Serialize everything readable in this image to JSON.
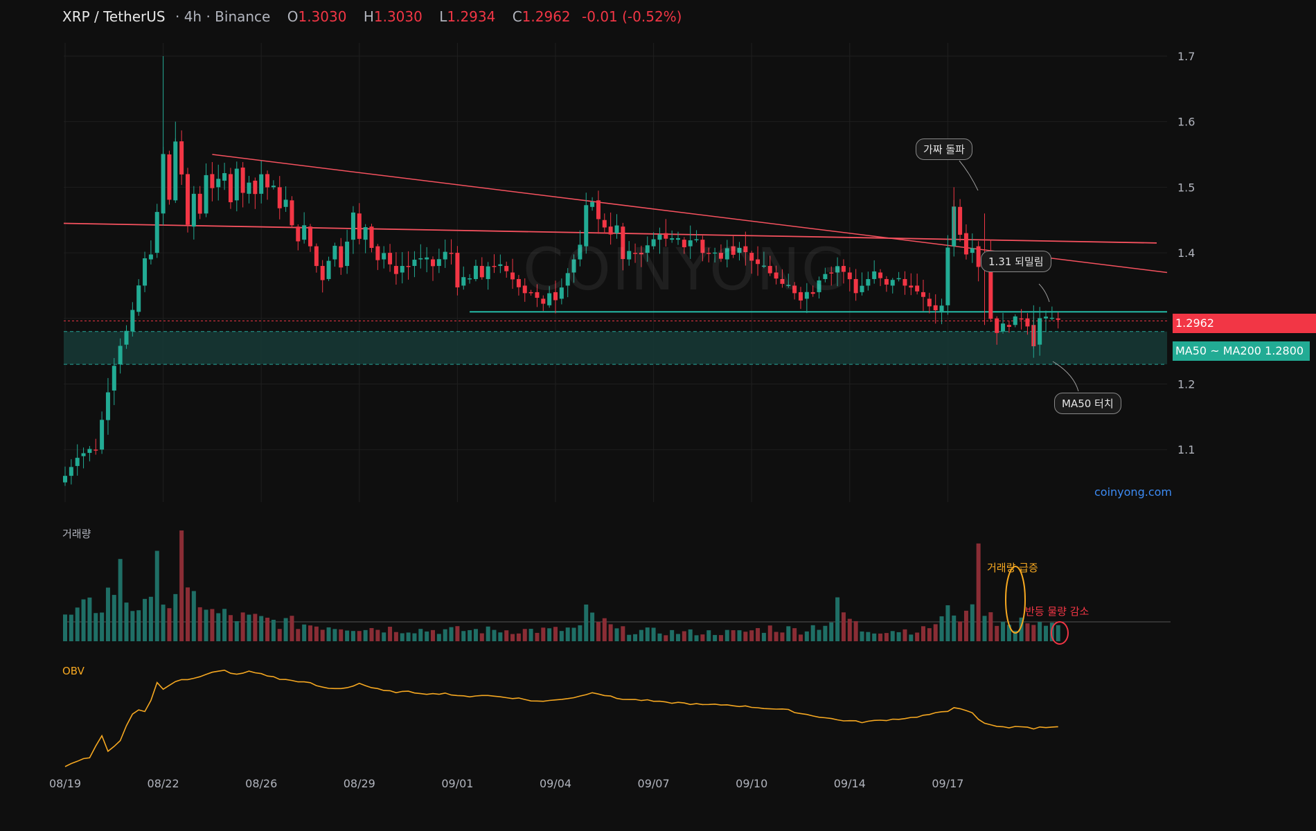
{
  "header": {
    "symbol": "XRP / TetherUS",
    "interval_exchange": "· 4h · Binance",
    "open_label": "O",
    "open": "1.3030",
    "high_label": "H",
    "high": "1.3030",
    "low_label": "L",
    "low": "1.2934",
    "close_label": "C",
    "close": "1.2962",
    "change": "-0.01 (-0.52%)"
  },
  "watermark": "COINYONG",
  "site": "coinyong.com",
  "panes": {
    "volume_title": "거래량",
    "obv_title": "OBV"
  },
  "price_tags": {
    "last": "1.2962",
    "ma_zone": "MA50 ~ MA200 1.2800"
  },
  "annotations": {
    "fake_breakout": "가짜 돌파",
    "pullback": "1.31 되밀림",
    "ma50_touch": "MA50 터치",
    "volume_spike": "거래량 급증",
    "rebound_volume_drop": "반등 물량 감소"
  },
  "colors": {
    "up": "#22ab94",
    "down": "#f23645",
    "background": "#0f0f0f",
    "obv": "#f6a821",
    "trendline": "#f7525f",
    "support": "#26c6b0"
  },
  "chart_data": {
    "type": "candlestick",
    "title": "XRP / TetherUS · 4h · Binance",
    "x_ticks": [
      "08/19",
      "08/22",
      "08/26",
      "08/29",
      "09/01",
      "09/04",
      "09/07",
      "09/10",
      "09/14",
      "09/17"
    ],
    "y_ticks": [
      1.1,
      1.2,
      1.3,
      1.4,
      1.5,
      1.6,
      1.7
    ],
    "ylim": [
      1.02,
      1.72
    ],
    "x_index_range": [
      0,
      180
    ],
    "last_price": 1.2962,
    "support_line": 1.31,
    "ma_zone": [
      1.23,
      1.28
    ],
    "candle_anchors_close": [
      [
        0,
        1.06
      ],
      [
        2,
        1.09
      ],
      [
        4,
        1.1
      ],
      [
        5,
        1.1
      ],
      [
        7,
        1.19
      ],
      [
        8,
        1.23
      ],
      [
        9,
        1.26
      ],
      [
        10,
        1.28
      ],
      [
        11,
        1.31
      ],
      [
        12,
        1.35
      ],
      [
        13,
        1.39
      ],
      [
        14,
        1.4
      ],
      [
        15,
        1.46
      ],
      [
        16,
        1.55
      ],
      [
        17,
        1.48
      ],
      [
        18,
        1.57
      ],
      [
        19,
        1.52
      ],
      [
        20,
        1.44
      ],
      [
        21,
        1.49
      ],
      [
        22,
        1.46
      ],
      [
        23,
        1.52
      ],
      [
        24,
        1.5
      ],
      [
        25,
        1.51
      ],
      [
        26,
        1.52
      ],
      [
        27,
        1.48
      ],
      [
        28,
        1.53
      ],
      [
        29,
        1.49
      ],
      [
        30,
        1.51
      ],
      [
        31,
        1.49
      ],
      [
        32,
        1.52
      ],
      [
        33,
        1.5
      ],
      [
        34,
        1.5
      ],
      [
        35,
        1.47
      ],
      [
        36,
        1.48
      ],
      [
        37,
        1.44
      ],
      [
        38,
        1.42
      ],
      [
        39,
        1.44
      ],
      [
        40,
        1.41
      ],
      [
        41,
        1.38
      ],
      [
        42,
        1.36
      ],
      [
        43,
        1.39
      ],
      [
        44,
        1.41
      ],
      [
        45,
        1.38
      ],
      [
        46,
        1.42
      ],
      [
        47,
        1.46
      ],
      [
        48,
        1.42
      ],
      [
        49,
        1.44
      ],
      [
        50,
        1.41
      ],
      [
        51,
        1.39
      ],
      [
        52,
        1.4
      ],
      [
        53,
        1.38
      ],
      [
        54,
        1.37
      ],
      [
        55,
        1.38
      ],
      [
        56,
        1.38
      ],
      [
        57,
        1.39
      ],
      [
        58,
        1.39
      ],
      [
        59,
        1.39
      ],
      [
        60,
        1.38
      ],
      [
        62,
        1.4
      ],
      [
        63,
        1.4
      ],
      [
        64,
        1.35
      ],
      [
        65,
        1.36
      ],
      [
        66,
        1.36
      ],
      [
        67,
        1.38
      ],
      [
        68,
        1.36
      ],
      [
        69,
        1.38
      ],
      [
        70,
        1.38
      ],
      [
        71,
        1.38
      ],
      [
        72,
        1.37
      ],
      [
        74,
        1.35
      ],
      [
        75,
        1.34
      ],
      [
        76,
        1.34
      ],
      [
        77,
        1.33
      ],
      [
        78,
        1.32
      ],
      [
        79,
        1.34
      ],
      [
        80,
        1.33
      ],
      [
        81,
        1.35
      ],
      [
        82,
        1.37
      ],
      [
        83,
        1.39
      ],
      [
        84,
        1.41
      ],
      [
        85,
        1.47
      ],
      [
        86,
        1.48
      ],
      [
        87,
        1.45
      ],
      [
        88,
        1.44
      ],
      [
        89,
        1.43
      ],
      [
        90,
        1.44
      ],
      [
        91,
        1.39
      ],
      [
        92,
        1.4
      ],
      [
        93,
        1.4
      ],
      [
        94,
        1.4
      ],
      [
        95,
        1.41
      ],
      [
        96,
        1.42
      ],
      [
        97,
        1.43
      ],
      [
        98,
        1.42
      ],
      [
        99,
        1.42
      ],
      [
        100,
        1.42
      ],
      [
        101,
        1.41
      ],
      [
        102,
        1.42
      ],
      [
        103,
        1.42
      ],
      [
        104,
        1.4
      ],
      [
        105,
        1.4
      ],
      [
        106,
        1.4
      ],
      [
        107,
        1.39
      ],
      [
        108,
        1.41
      ],
      [
        109,
        1.4
      ],
      [
        110,
        1.41
      ],
      [
        111,
        1.4
      ],
      [
        112,
        1.39
      ],
      [
        113,
        1.38
      ],
      [
        114,
        1.38
      ],
      [
        115,
        1.37
      ],
      [
        116,
        1.36
      ],
      [
        117,
        1.35
      ],
      [
        118,
        1.35
      ],
      [
        119,
        1.34
      ],
      [
        120,
        1.33
      ],
      [
        121,
        1.34
      ],
      [
        122,
        1.34
      ],
      [
        123,
        1.36
      ],
      [
        124,
        1.37
      ],
      [
        125,
        1.37
      ],
      [
        126,
        1.38
      ],
      [
        127,
        1.37
      ],
      [
        128,
        1.36
      ],
      [
        129,
        1.34
      ],
      [
        130,
        1.35
      ],
      [
        131,
        1.36
      ],
      [
        132,
        1.37
      ],
      [
        133,
        1.36
      ],
      [
        134,
        1.35
      ],
      [
        135,
        1.36
      ],
      [
        136,
        1.36
      ],
      [
        137,
        1.35
      ],
      [
        138,
        1.35
      ],
      [
        139,
        1.34
      ],
      [
        140,
        1.33
      ],
      [
        142,
        1.31
      ],
      [
        143,
        1.32
      ],
      [
        144,
        1.41
      ],
      [
        145,
        1.47
      ],
      [
        146,
        1.43
      ],
      [
        147,
        1.4
      ],
      [
        148,
        1.41
      ],
      [
        149,
        1.38
      ],
      [
        150,
        1.4
      ],
      [
        151,
        1.3
      ],
      [
        152,
        1.28
      ],
      [
        153,
        1.29
      ],
      [
        154,
        1.29
      ],
      [
        155,
        1.3
      ],
      [
        156,
        1.3
      ],
      [
        157,
        1.29
      ],
      [
        158,
        1.26
      ],
      [
        159,
        1.3
      ],
      [
        160,
        1.3
      ],
      [
        161,
        1.3
      ],
      [
        162,
        1.3
      ]
    ],
    "volume_anchors": [
      [
        0,
        0.2
      ],
      [
        2,
        0.25
      ],
      [
        4,
        0.3
      ],
      [
        6,
        0.35
      ],
      [
        8,
        0.5
      ],
      [
        9,
        0.6
      ],
      [
        10,
        0.4
      ],
      [
        11,
        0.3
      ],
      [
        12,
        0.35
      ],
      [
        13,
        0.45
      ],
      [
        14,
        0.3
      ],
      [
        15,
        0.6
      ],
      [
        16,
        0.55
      ],
      [
        17,
        0.35
      ],
      [
        18,
        0.5
      ],
      [
        19,
        0.9
      ],
      [
        20,
        0.35
      ],
      [
        22,
        0.4
      ],
      [
        24,
        0.25
      ],
      [
        30,
        0.2
      ],
      [
        40,
        0.15
      ],
      [
        50,
        0.12
      ],
      [
        60,
        0.1
      ],
      [
        70,
        0.1
      ],
      [
        80,
        0.1
      ],
      [
        84,
        0.12
      ],
      [
        85,
        0.25
      ],
      [
        90,
        0.1
      ],
      [
        100,
        0.08
      ],
      [
        110,
        0.08
      ],
      [
        115,
        0.12
      ],
      [
        120,
        0.1
      ],
      [
        125,
        0.18
      ],
      [
        126,
        0.3
      ],
      [
        130,
        0.1
      ],
      [
        140,
        0.1
      ],
      [
        143,
        0.2
      ],
      [
        144,
        0.25
      ],
      [
        145,
        0.3
      ],
      [
        146,
        0.25
      ],
      [
        147,
        0.2
      ],
      [
        148,
        0.5
      ],
      [
        149,
        0.7
      ],
      [
        150,
        0.35
      ],
      [
        151,
        0.28
      ],
      [
        152,
        0.2
      ],
      [
        155,
        0.1
      ],
      [
        157,
        0.22
      ],
      [
        160,
        0.15
      ],
      [
        162,
        0.12
      ]
    ],
    "obv_anchors": [
      [
        0,
        0.06
      ],
      [
        2,
        0.12
      ],
      [
        4,
        0.15
      ],
      [
        6,
        0.35
      ],
      [
        7,
        0.2
      ],
      [
        9,
        0.3
      ],
      [
        10,
        0.45
      ],
      [
        11,
        0.55
      ],
      [
        12,
        0.6
      ],
      [
        13,
        0.58
      ],
      [
        14,
        0.68
      ],
      [
        15,
        0.85
      ],
      [
        16,
        0.78
      ],
      [
        17,
        0.82
      ],
      [
        18,
        0.86
      ],
      [
        19,
        0.88
      ],
      [
        20,
        0.88
      ],
      [
        22,
        0.9
      ],
      [
        24,
        0.94
      ],
      [
        26,
        0.96
      ],
      [
        28,
        0.92
      ],
      [
        30,
        0.95
      ],
      [
        32,
        0.93
      ],
      [
        35,
        0.88
      ],
      [
        38,
        0.86
      ],
      [
        40,
        0.84
      ],
      [
        42,
        0.8
      ],
      [
        44,
        0.79
      ],
      [
        46,
        0.8
      ],
      [
        48,
        0.84
      ],
      [
        50,
        0.8
      ],
      [
        52,
        0.77
      ],
      [
        54,
        0.76
      ],
      [
        56,
        0.76
      ],
      [
        58,
        0.75
      ],
      [
        60,
        0.74
      ],
      [
        62,
        0.75
      ],
      [
        64,
        0.72
      ],
      [
        66,
        0.72
      ],
      [
        68,
        0.73
      ],
      [
        70,
        0.72
      ],
      [
        72,
        0.71
      ],
      [
        74,
        0.7
      ],
      [
        76,
        0.68
      ],
      [
        78,
        0.67
      ],
      [
        80,
        0.69
      ],
      [
        82,
        0.7
      ],
      [
        84,
        0.72
      ],
      [
        86,
        0.76
      ],
      [
        88,
        0.73
      ],
      [
        90,
        0.7
      ],
      [
        92,
        0.69
      ],
      [
        95,
        0.68
      ],
      [
        98,
        0.66
      ],
      [
        100,
        0.66
      ],
      [
        102,
        0.65
      ],
      [
        104,
        0.64
      ],
      [
        106,
        0.64
      ],
      [
        108,
        0.64
      ],
      [
        110,
        0.63
      ],
      [
        112,
        0.62
      ],
      [
        114,
        0.61
      ],
      [
        116,
        0.6
      ],
      [
        118,
        0.59
      ],
      [
        120,
        0.56
      ],
      [
        122,
        0.54
      ],
      [
        124,
        0.52
      ],
      [
        126,
        0.5
      ],
      [
        128,
        0.49
      ],
      [
        130,
        0.48
      ],
      [
        132,
        0.49
      ],
      [
        134,
        0.5
      ],
      [
        136,
        0.51
      ],
      [
        138,
        0.52
      ],
      [
        140,
        0.54
      ],
      [
        142,
        0.56
      ],
      [
        144,
        0.58
      ],
      [
        145,
        0.62
      ],
      [
        146,
        0.61
      ],
      [
        147,
        0.58
      ],
      [
        148,
        0.56
      ],
      [
        149,
        0.5
      ],
      [
        150,
        0.47
      ],
      [
        151,
        0.45
      ],
      [
        152,
        0.44
      ],
      [
        153,
        0.44
      ],
      [
        154,
        0.43
      ],
      [
        155,
        0.44
      ],
      [
        156,
        0.43
      ],
      [
        157,
        0.43
      ],
      [
        158,
        0.42
      ],
      [
        159,
        0.43
      ],
      [
        160,
        0.43
      ],
      [
        161,
        0.44
      ],
      [
        162,
        0.44
      ]
    ]
  }
}
